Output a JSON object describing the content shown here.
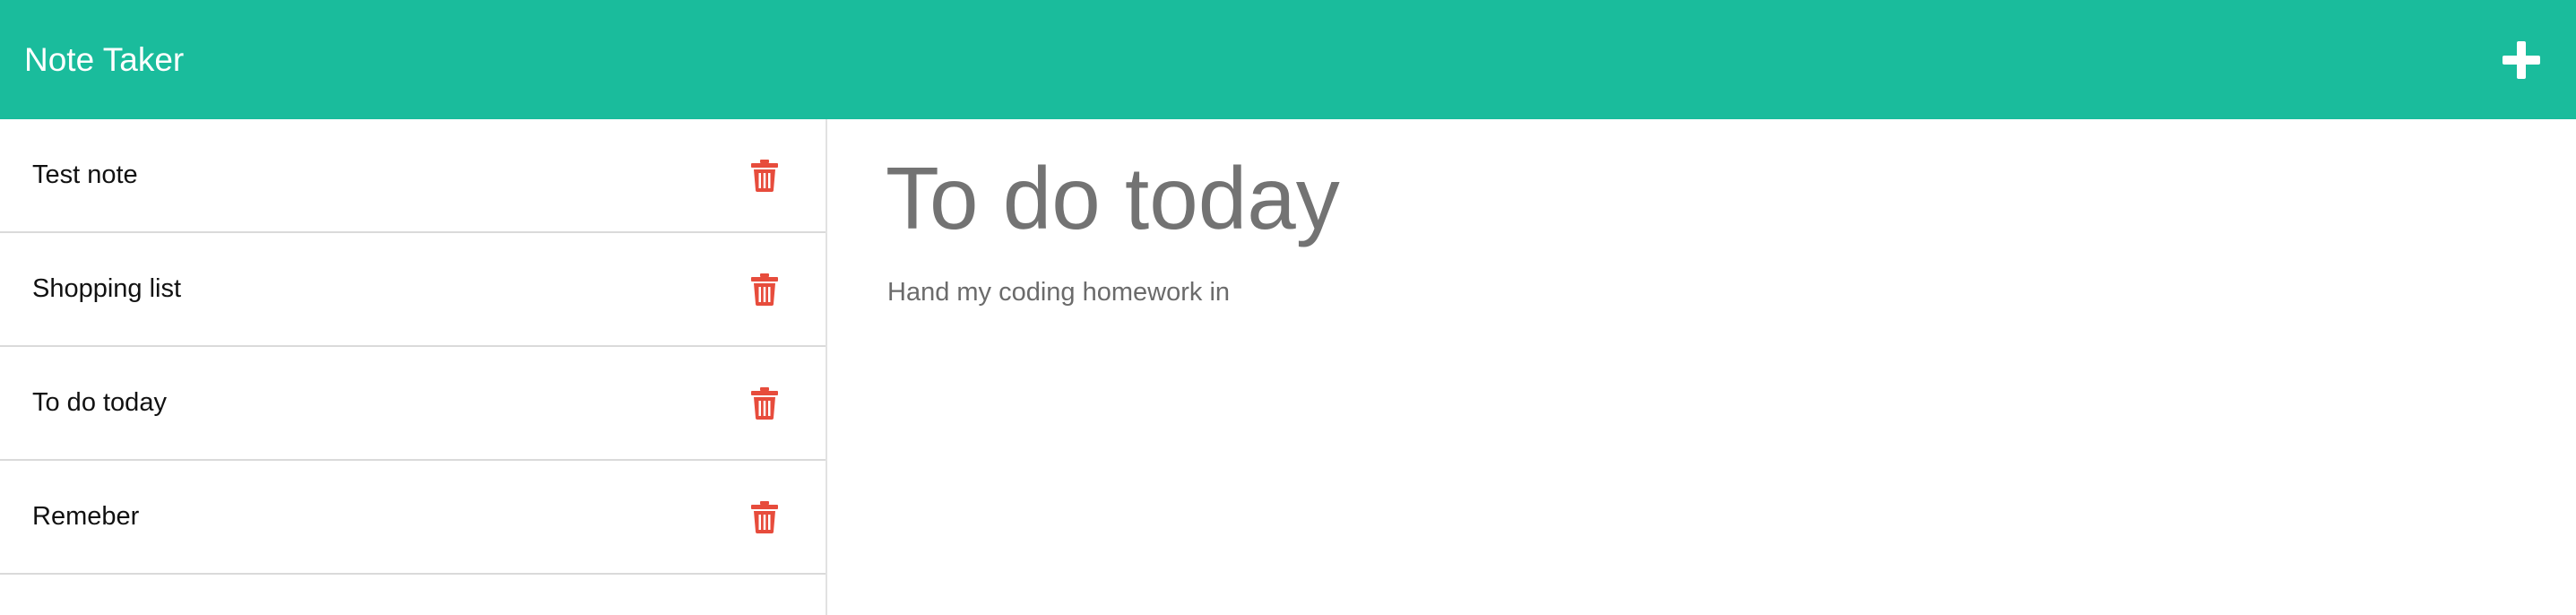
{
  "navbar": {
    "brand": "Note Taker",
    "add_icon": "plus-icon",
    "background_color": "#1abc9c"
  },
  "sidebar": {
    "notes": [
      {
        "title": "Test note",
        "delete_icon": "trash-icon"
      },
      {
        "title": "Shopping list",
        "delete_icon": "trash-icon"
      },
      {
        "title": "To do today",
        "delete_icon": "trash-icon"
      },
      {
        "title": "Remeber",
        "delete_icon": "trash-icon"
      }
    ],
    "delete_icon_color": "#e74c3c"
  },
  "editor": {
    "title": "To do today",
    "body": "Hand my coding homework in"
  }
}
